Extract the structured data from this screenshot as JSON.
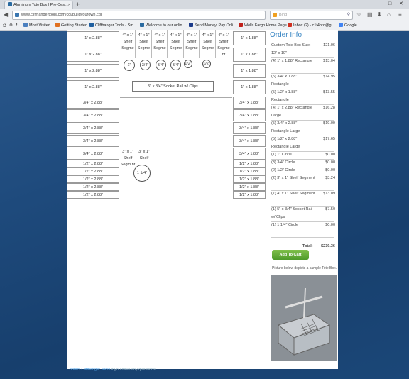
{
  "browser": {
    "tab_title": "Aluminum Tote Box | Pre-Desi...",
    "new_tab": "+",
    "url": "www.cliffhangertools.com/cgi/buildyourown.cgi",
    "search_placeholder": "Bing",
    "bookmarks": [
      "Most Visited",
      "Getting Started",
      "Cliffhanger Tools - Sm...",
      "Welcome to our onlin...",
      "Send Money, Pay Onli...",
      "Wells Fargo Home Page",
      "Inbox (2) - c1f4ord@g...",
      "Google"
    ],
    "colors": {
      "bookmark_icons": [
        "#4a7fbf",
        "#e07020",
        "#1f5fa0",
        "#2a6aa0",
        "#1a3a8a",
        "#c0201a",
        "#d03020",
        "#4285f4"
      ]
    }
  },
  "tote": {
    "left_col_top": [
      "1\" x 2.88\"",
      "1\" x 2.88\"",
      "1\" x 2.88\"",
      "1\" x 2.88\""
    ],
    "left_col_mid": [
      "3/4\" x 2.88\"",
      "3/4\" x 2.88\"",
      "3/4\" x 2.88\"",
      "3/4\" x 2.88\"",
      "3/4\" x 2.88\""
    ],
    "left_col_bot": [
      "1/2\" x 2.88\"",
      "1/2\" x 2.88\"",
      "1/2\" x 2.88\"",
      "1/2\" x 2.88\"",
      "1/2\" x 2.88\""
    ],
    "right_col_top": [
      "1\" x 1.88\"",
      "1\" x 1.88\"",
      "1\" x 1.88\"",
      "1\" x 1.88\""
    ],
    "right_col_mid": [
      "3/4\" x 1.88\"",
      "3/4\" x 1.88\"",
      "3/4\" x 1.88\"",
      "3/4\" x 1.88\"",
      "3/4\" x 1.88\""
    ],
    "right_col_bot": [
      "1/2\" x 1.88\"",
      "1/2\" x 1.88\"",
      "1/2\" x 1.88\"",
      "1/2\" x 1.88\"",
      "1/2\" x 1.88\""
    ],
    "shelf_segments_top": [
      "4\" x 1\" Shelf Segme",
      "4\" x 1\" Shelf Segme",
      "4\" x 1\" Shelf Segme",
      "4\" x 1\" Shelf Segme",
      "4\" x 1\" Shelf Segme",
      "4\" x 1\" Shelf Segme",
      "4\" x 1\" Shelf Segme nt"
    ],
    "circles_top": [
      "1\"",
      "3/4\"",
      "3/4\"",
      "3/4\"",
      "1/2\"",
      "1/2\""
    ],
    "socket_rail": "5\" x 3/4\" Socket Rail w/ Clips",
    "shelf_segments_bottom": [
      "3\" x 1\" Shelf Segm nt",
      "3\" x 1\" Shelf"
    ],
    "circle_bottom": "1 1/4\""
  },
  "order": {
    "title": "Order Info",
    "items": [
      {
        "label": "Custom Tote Box Size: 12\" x 10\"",
        "price": "121.06"
      },
      {
        "label": "(4) 1\" x 1.88\" Rectangle",
        "price": "$13.04"
      },
      {
        "label": "(5) 3/4\" x 1.88\" Rectangle",
        "price": "$14.95"
      },
      {
        "label": "(5) 1/2\" x 1.88\" Rectangle",
        "price": "$13.55"
      },
      {
        "label": "(4) 1\" x 2.88\" Rectangle Large",
        "price": "$16.28"
      },
      {
        "label": "(5) 3/4\" x 2.88\" Rectangle Large",
        "price": "$19.00"
      },
      {
        "label": "(5) 1/2\" x 2.88\" Rectangle Large",
        "price": "$17.65"
      },
      {
        "label": "(1) 1\" Circle",
        "price": "$0.00"
      },
      {
        "label": "(3) 3/4\" Circle",
        "price": "$0.00"
      },
      {
        "label": "(2) 1/2\" Circle",
        "price": "$0.00"
      },
      {
        "label": "(2) 3\" x 1\" Shelf Segment",
        "price": "$3.24"
      },
      {
        "label": "(7) 4\" x 1\" Shelf Segment",
        "price": "$13.09"
      },
      {
        "label": "(1) 5\" x 3/4\" Socket Rail w/ Clips",
        "price": "$7.50"
      },
      {
        "label": "(1) 1 1/4\" Circle",
        "price": "$0.00"
      }
    ],
    "total_label": "Total:",
    "total": "$239.36",
    "add_to_cart": "Add To Cart",
    "picture_note": "Picture below depicts a sample Tote Box."
  },
  "footer": {
    "link": "Contact Cliffhanger Tools",
    "text": " if you have any questions."
  }
}
